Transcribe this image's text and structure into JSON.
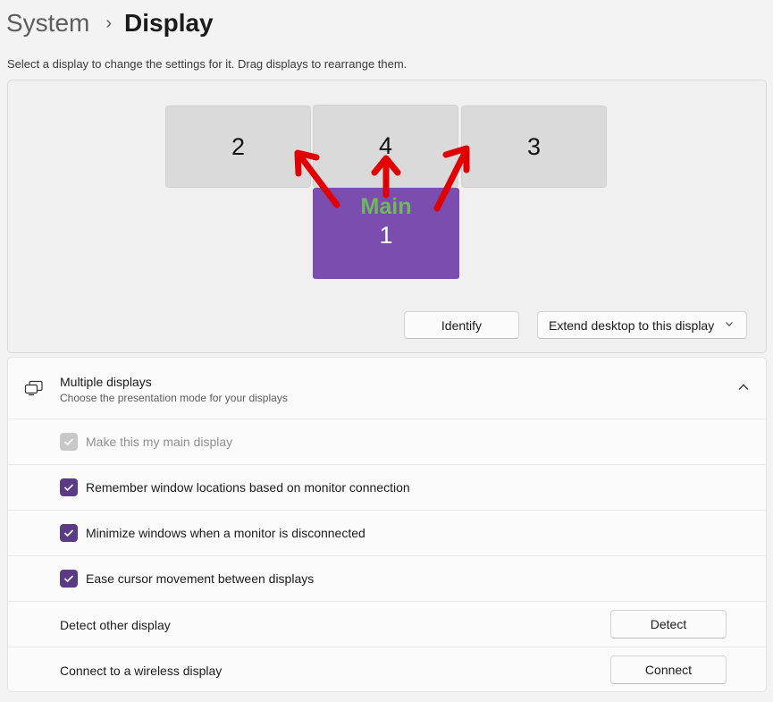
{
  "breadcrumb": {
    "parent": "System",
    "separator": "›",
    "current": "Display"
  },
  "hint": "Select a display to change the settings for it. Drag displays to rearrange them.",
  "monitors": {
    "left": "2",
    "center": "4",
    "right": "3",
    "main_tag": "Main",
    "main_number": "1"
  },
  "colors": {
    "main_display": "#7a4dae",
    "main_tag": "#6fb95c",
    "accent_check": "#5b3a86",
    "arrow": "#e00000"
  },
  "identify_label": "Identify",
  "extend_dropdown": {
    "selected": "Extend desktop to this display"
  },
  "multiple_displays": {
    "icon": "multiple-displays-icon",
    "title": "Multiple displays",
    "subtitle": "Choose the presentation mode for your displays",
    "expanded": true,
    "checkboxes": [
      {
        "label": "Make this my main display",
        "checked": true,
        "disabled": true
      },
      {
        "label": "Remember window locations based on monitor connection",
        "checked": true,
        "disabled": false
      },
      {
        "label": "Minimize windows when a monitor is disconnected",
        "checked": true,
        "disabled": false
      },
      {
        "label": "Ease cursor movement between displays",
        "checked": true,
        "disabled": false
      }
    ],
    "detect": {
      "label": "Detect other display",
      "button": "Detect"
    },
    "connect": {
      "label": "Connect to a wireless display",
      "button": "Connect"
    }
  }
}
